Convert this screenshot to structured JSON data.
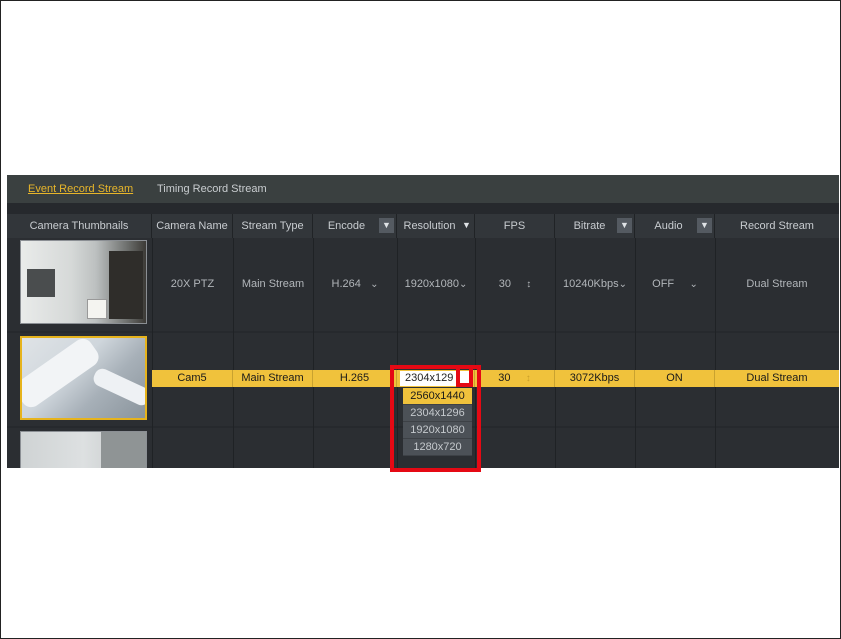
{
  "tabs": [
    "Event Record Stream",
    "Timing Record Stream"
  ],
  "headers": {
    "thumbnails": "Camera Thumbnails",
    "camera_name": "Camera Name",
    "stream_type": "Stream Type",
    "encode": "Encode",
    "resolution": "Resolution",
    "fps": "FPS",
    "bitrate": "Bitrate",
    "audio": "Audio",
    "record_stream": "Record Stream"
  },
  "rows": [
    {
      "camera_name": "20X PTZ",
      "stream_type": "Main Stream",
      "encode": "H.264",
      "resolution": "1920x1080",
      "fps": "30",
      "bitrate": "10240Kbps",
      "audio": "OFF",
      "record_stream": "Dual Stream"
    },
    {
      "camera_name": "Cam5",
      "stream_type": "Main Stream",
      "encode": "H.265",
      "resolution": "2304x1296",
      "fps": "30",
      "bitrate": "3072Kbps",
      "audio": "ON",
      "record_stream": "Dual Stream"
    }
  ],
  "resolution_dropdown": {
    "current": "2304x129",
    "options": [
      "2560x1440",
      "2304x1296",
      "1920x1080",
      "1280x720"
    ],
    "highlighted_index": 0
  },
  "icons": {
    "dropdown": "chevron-down-icon",
    "stepper": "up-down-stepper-icon"
  },
  "colors": {
    "accent": "#f0c23c",
    "annotation": "#e50914",
    "panel": "#26292d"
  }
}
